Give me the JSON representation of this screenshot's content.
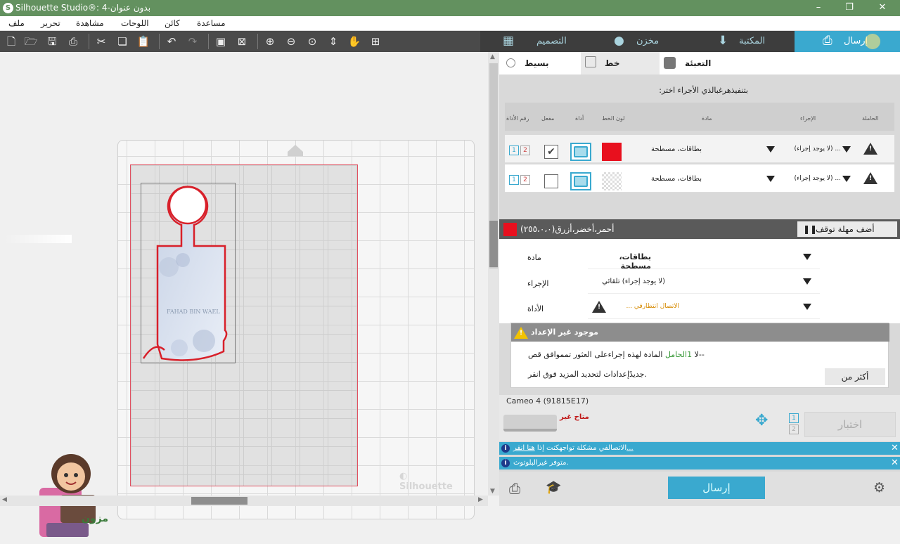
{
  "window": {
    "title": "Silhouette Studio®: 4-بدون عنوان",
    "minimize": "–",
    "restore": "❐",
    "close": "✕"
  },
  "menu": [
    "ملف",
    "تحرير",
    "مشاهدة",
    "اللوحات",
    "كائن",
    "مساعدة"
  ],
  "tabs": {
    "design": "التصميم",
    "store": "مخزن",
    "library": "المكتبة",
    "send": "إرسال"
  },
  "subtabs": {
    "simple": "بسيط",
    "line": "خط",
    "fill": "التعبئة"
  },
  "panel": {
    "headline": ":بتنفيذهرغبالذي الأجراء اختر",
    "columns": {
      "tool_number": "رقم الأداة",
      "enabled": "مفعل",
      "tool": "أداة",
      "line_color": "لون الخط",
      "material": "مادة",
      "action": "الإجراء",
      "holder": "الحاملة"
    },
    "rows": [
      {
        "material": "بطاقات، مسطحة",
        "action": "... (لا يوجد إجراء)",
        "checked": true,
        "color": "#e8101e",
        "num1": "1",
        "num2": "2"
      },
      {
        "material": "بطاقات، مسطحة",
        "action": "... (لا يوجد إجراء)",
        "checked": false,
        "color": "pattern",
        "num1": "1",
        "num2": "2"
      }
    ]
  },
  "color_section": {
    "title": "أحمر،أخضر،أزرق(٢٥٥،٠،٠)",
    "pause_button": "أضف مهلة توقف",
    "material_label": "مادة",
    "material_value": "بطاقات، مسطحة",
    "action_label": "الإجراء",
    "action_value": "(لا يوجد إجراء) تلقائي",
    "tool_label": "الأداة",
    "tool_value": "الاتصال انتظارقي ..."
  },
  "notice": {
    "title": "موجود غير الإعداد",
    "line1_a": "المادة لهذه إجراءعلى العثور تمموافق قص--",
    "line1_b": "1الحامل",
    "line1_c": " لا",
    "line2": "جديدًإعدادات لتحديد المزيد فوق انقر.",
    "more_button": "أكثر من"
  },
  "device": {
    "name": "Cameo 4 (91815E17)",
    "status": "متاح غير",
    "test_button": "اختبار"
  },
  "status_bars": [
    {
      "text": "الاتصالفي مشكلة تواجهكنت إذا ",
      "link": "هنا انقر..."
    },
    {
      "text": "متوفر غيرالبلوتوث.",
      "link": ""
    }
  ],
  "design_text": "FAHAD BIN WAEL",
  "send_button": "إرسال",
  "colors": {
    "titlebar": "#63915f",
    "accent": "#3aa9cf",
    "red": "#e8101e"
  }
}
